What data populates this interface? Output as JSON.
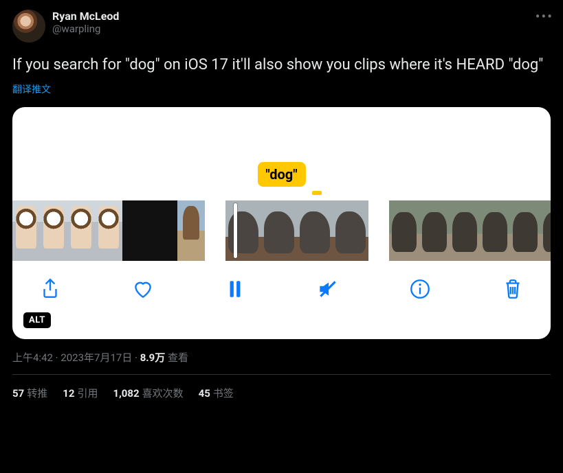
{
  "author": {
    "name": "Ryan McLeod",
    "handle": "@warpling"
  },
  "tweet_text": "If you search for \"dog\" on iOS 17 it'll also show you clips where it's HEARD \"dog\"",
  "translate_label": "翻译推文",
  "media": {
    "search_label": "\"dog\"",
    "alt_badge": "ALT",
    "toolbar_icons": [
      "share",
      "heart",
      "pause",
      "mute",
      "info",
      "trash"
    ]
  },
  "timestamp": {
    "time": "上午4:42",
    "dot": " · ",
    "date": "2023年7月17日",
    "views_count": "8.9万",
    "views_label": " 查看"
  },
  "stats": {
    "retweets_count": "57",
    "retweets_label": "转推",
    "quotes_count": "12",
    "quotes_label": "引用",
    "likes_count": "1,082",
    "likes_label": "喜欢次数",
    "bookmarks_count": "45",
    "bookmarks_label": "书签"
  }
}
